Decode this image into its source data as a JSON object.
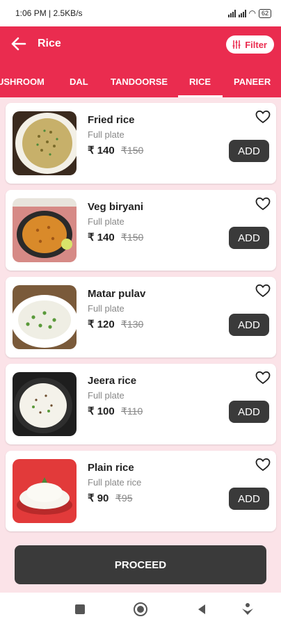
{
  "status_bar": {
    "time": "1:06 PM",
    "speed": "| 2.5KB/s",
    "battery": "62"
  },
  "appbar": {
    "title": "Rice",
    "filter_label": "Filter"
  },
  "tabs": [
    {
      "label": "USHROOM"
    },
    {
      "label": "DAL"
    },
    {
      "label": "TANDOORSE"
    },
    {
      "label": "RICE",
      "active": true
    },
    {
      "label": "PANEER"
    }
  ],
  "items": [
    {
      "name": "Fried rice",
      "desc": "Full plate",
      "price": "₹ 140",
      "mrp": "₹150",
      "add_label": "ADD",
      "image": "fried-rice-photo"
    },
    {
      "name": "Veg biryani",
      "desc": "Full plate",
      "price": "₹ 140",
      "mrp": "₹150",
      "add_label": "ADD",
      "image": "veg-biryani-photo"
    },
    {
      "name": "Matar pulav",
      "desc": "Full plate",
      "price": "₹ 120",
      "mrp": "₹130",
      "add_label": "ADD",
      "image": "matar-pulav-photo"
    },
    {
      "name": "Jeera rice",
      "desc": "Full plate",
      "price": "₹ 100",
      "mrp": "₹110",
      "add_label": "ADD",
      "image": "jeera-rice-photo"
    },
    {
      "name": "Plain rice",
      "desc": "Full plate rice",
      "price": "₹ 90",
      "mrp": "₹95",
      "add_label": "ADD",
      "image": "plain-rice-photo"
    }
  ],
  "proceed_label": "PROCEED",
  "colors": {
    "brand": "#ea2c4f",
    "button": "#3a3a3a",
    "background": "#fbe3e8"
  },
  "nav_icons": [
    "recent-apps-icon",
    "home-icon",
    "back-icon",
    "assistant-icon"
  ]
}
